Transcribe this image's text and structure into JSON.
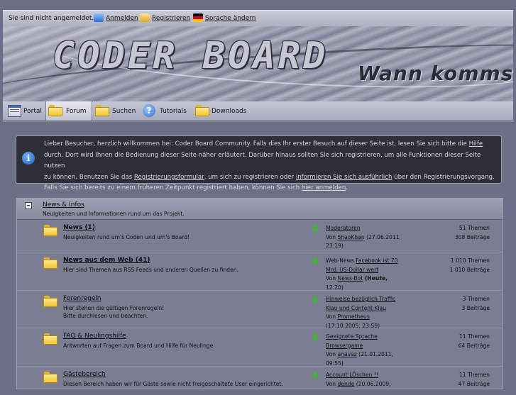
{
  "topbar": {
    "status_text": "Sie sind nicht angemeldet.",
    "login_label": "Anmelden",
    "register_label": "Registrieren",
    "language_label": "Sprache ändern"
  },
  "banner": {
    "logo_text": "CODER BOARD",
    "slogan_text": "Wann kommst d"
  },
  "nav": {
    "tabs": [
      {
        "label": "Portal",
        "icon": "portal-icon"
      },
      {
        "label": "Forum",
        "icon": "folder-icon",
        "active": true
      },
      {
        "label": "Suchen",
        "icon": "folder-icon"
      },
      {
        "label": "Tutorials",
        "icon": "help-icon"
      },
      {
        "label": "Downloads",
        "icon": "folder-icon"
      }
    ]
  },
  "info": {
    "p1": "Lieber Besucher, herzlich willkommen bei: Coder Board Community. Falls dies Ihr erster Besuch auf dieser Seite ist, lesen Sie sich bitte die ",
    "help_link": "Hilfe",
    "p2": "durch. Dort wird Ihnen die Bedienung dieser Seite näher erläutert. Darüber hinaus sollten Sie sich registrieren, um alle Funktionen dieser Seite nutzen",
    "p3": "zu können. Benutzen Sie das ",
    "form_link": "Registrierungsformular",
    "p3b": ", um sich zu registrieren oder ",
    "inform_link": "informieren Sie sich ausführlich",
    "p3c": " über den Registrierungsvorgang.",
    "p4": "Falls Sie sich bereits zu einem früheren Zeitpunkt registriert haben, können Sie sich ",
    "login_link": "hier anmelden",
    "p4b": "."
  },
  "category": {
    "title": "News & Infos",
    "description": "Neuigkeiten und Informationen rund um das Projekt."
  },
  "forums": [
    {
      "name": "News (1)",
      "bold": true,
      "desc1": "Neuigkeiten rund um's Coden und um's Board!",
      "desc2": "",
      "last_title1": "Moderatoren",
      "last_title2": "",
      "last_by": "Von ",
      "last_user": "ShaoKhan",
      "last_date": " (27.06.2011,",
      "last_time": "23:19)",
      "threads": "51",
      "threads_label": "Themen",
      "posts": "308",
      "posts_label": "Beiträge"
    },
    {
      "name": "News aus dem Web (41)",
      "bold": true,
      "desc1": "Hier sind Themen aus RSS Feeds und anderen Quellen zu finden.",
      "desc2": "",
      "last_title1": "Web-News ",
      "last_title1b": "Facebook ist 70",
      "last_title2": "Mrd. US-Dollar wert",
      "last_by": "Von ",
      "last_user": "News-Bot",
      "last_date": " (Heute,",
      "last_time": "12:20)",
      "threads": "1 010",
      "threads_label": "Themen",
      "posts": "1 010",
      "posts_label": "Beiträge"
    },
    {
      "name": "Forenregeln",
      "bold": false,
      "desc1": "Hier stehen die gültigen Forenregeln!",
      "desc2": "Bitte durchlesen und beachten.",
      "last_title1": "Hinweise bezüglich Traffic",
      "last_title2": "Klau und Content Klau",
      "last_by": "Von ",
      "last_user": "Prometheus",
      "last_date": "",
      "last_time": "(17.10.2005, 23:59)",
      "threads": "3",
      "threads_label": "Themen",
      "posts": "3",
      "posts_label": "Beiträge"
    },
    {
      "name": "FAQ & Neulingshilfe",
      "bold": false,
      "desc1": "Antworten auf Fragen zum Board und Hilfe für Neulinge",
      "desc2": "",
      "last_title1": "Geeignete Sprache",
      "last_title2": "Browsergame",
      "last_by": "Von ",
      "last_user": "anavaz",
      "last_date": " (21.01.2011,",
      "last_time": "09:55)",
      "threads": "11",
      "threads_label": "Themen",
      "posts": "64",
      "posts_label": "Beiträge"
    },
    {
      "name": "Gästebereich",
      "bold": false,
      "desc1": "Diesen Bereich haben wir für Gäste sowie nicht freigeschaltete User eingerichtet.",
      "desc2": "",
      "last_title1": "Account LÖschen !!",
      "last_title2": "",
      "last_by": "Von ",
      "last_user": "dende",
      "last_date": " (20.06.2009,",
      "last_time": "",
      "threads": "11",
      "threads_label": "Themen",
      "posts": "47",
      "posts_label": "Beiträge"
    }
  ]
}
